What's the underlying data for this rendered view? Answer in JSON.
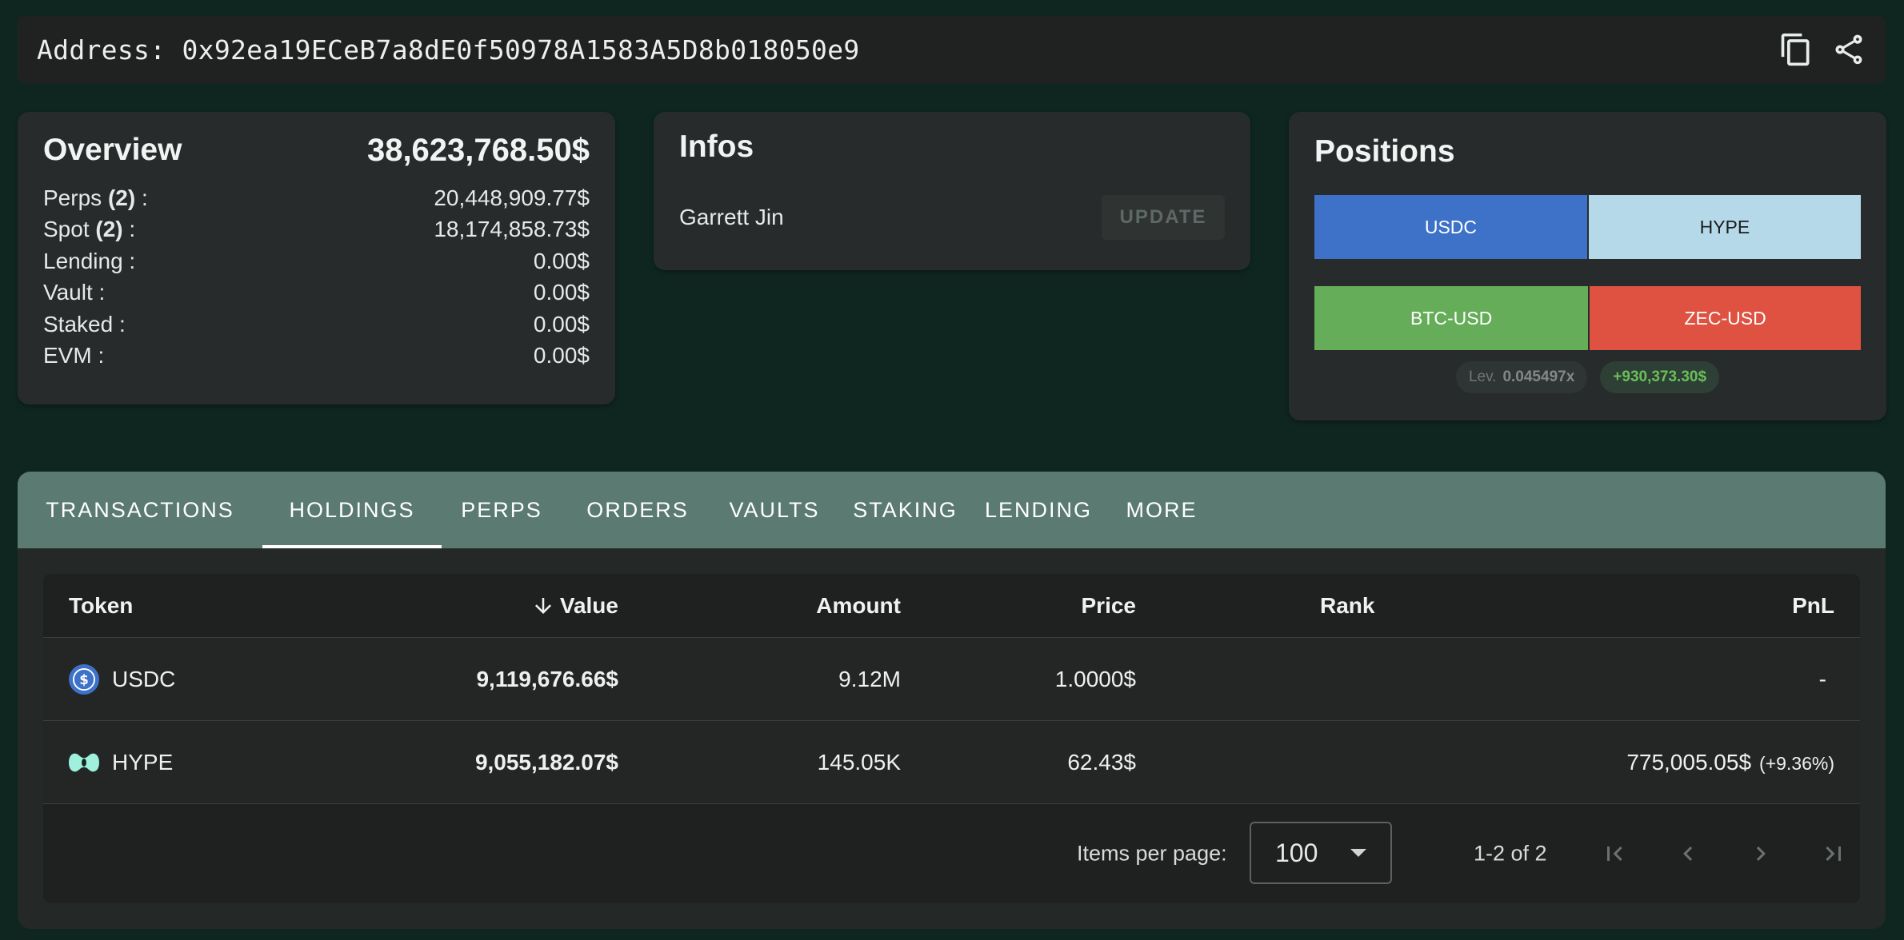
{
  "address": {
    "label": "Address: 0x92ea19ECeB7a8dE0f50978A1583A5D8b018050e9"
  },
  "overview": {
    "title": "Overview",
    "total": "38,623,768.50$",
    "rows": [
      {
        "label": "Perps ",
        "count": "(2)",
        "suffix": " :",
        "value": "20,448,909.77$"
      },
      {
        "label": "Spot ",
        "count": "(2)",
        "suffix": " :",
        "value": "18,174,858.73$"
      },
      {
        "label": "Lending :",
        "count": "",
        "suffix": "",
        "value": "0.00$"
      },
      {
        "label": "Vault :",
        "count": "",
        "suffix": "",
        "value": "0.00$"
      },
      {
        "label": "Staked :",
        "count": "",
        "suffix": "",
        "value": "0.00$"
      },
      {
        "label": "EVM :",
        "count": "",
        "suffix": "",
        "value": "0.00$"
      }
    ]
  },
  "infos": {
    "title": "Infos",
    "name": "Garrett Jin",
    "update_label": "UPDATE"
  },
  "positions": {
    "title": "Positions",
    "row1": [
      {
        "label": "USDC",
        "color": "#3e72c8"
      },
      {
        "label": "HYPE",
        "color": "#b6d9ea"
      }
    ],
    "row1_share": 0.502,
    "row2": [
      {
        "label": "BTC-USD",
        "color": "#66ad5a"
      },
      {
        "label": "ZEC-USD",
        "color": "#df5241"
      }
    ],
    "row2_share": 0.504,
    "lev_label": "Lev.",
    "lev_value": "0.045497x",
    "pnl": "+930,373.30$"
  },
  "tabs": [
    {
      "label": "TRANSACTIONS",
      "active": false
    },
    {
      "label": "HOLDINGS",
      "active": true
    },
    {
      "label": "PERPS",
      "active": false
    },
    {
      "label": "ORDERS",
      "active": false
    },
    {
      "label": "VAULTS",
      "active": false
    },
    {
      "label": "STAKING",
      "active": false
    },
    {
      "label": "LENDING",
      "active": false
    },
    {
      "label": "MORE",
      "active": false
    }
  ],
  "table": {
    "headers": {
      "token": "Token",
      "value": "Value",
      "amount": "Amount",
      "price": "Price",
      "rank": "Rank",
      "pnl": "PnL"
    },
    "rows": [
      {
        "token": "USDC",
        "icon": "usdc-icon",
        "value": "9,119,676.66$",
        "amount": "9.12M",
        "price": "1.0000$",
        "rank": "",
        "pnl": "-",
        "pnl_pct": ""
      },
      {
        "token": "HYPE",
        "icon": "hype-icon",
        "value": "9,055,182.07$",
        "amount": "145.05K",
        "price": "62.43$",
        "rank": "",
        "pnl": "775,005.05$",
        "pnl_pct": "(+9.36%)"
      }
    ]
  },
  "paginator": {
    "items_label": "Items per page:",
    "page_size": "100",
    "range": "1-2 of 2"
  }
}
